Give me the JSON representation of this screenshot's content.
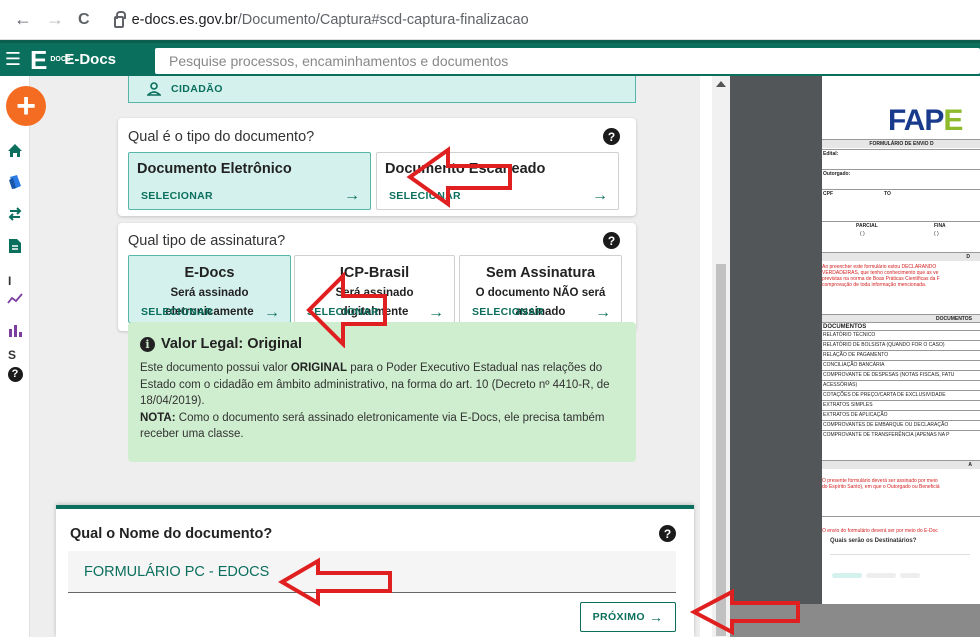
{
  "browser": {
    "back": "←",
    "forward": "→",
    "reload": "C",
    "url_host": "e-docs.es.gov.br",
    "url_path": "/Documento/Captura#scd-captura-finalizacao"
  },
  "app": {
    "name": "E-Docs",
    "logo_letter": "E",
    "logo_sub": "DOCS",
    "search_placeholder": "Pesquise processos, encaminhamentos e documentos"
  },
  "rail": {
    "add_label": "+",
    "sep1": "I",
    "sep2": "S",
    "help": "?"
  },
  "citizen_label": "CIDADÃO",
  "doc_type": {
    "title": "Qual é o tipo do documento?",
    "options": [
      {
        "title": "Documento Eletrônico",
        "action": "SELECIONAR"
      },
      {
        "title": "Documento Escaneado",
        "action": "SELECIONAR"
      }
    ]
  },
  "signature": {
    "title": "Qual tipo de assinatura?",
    "options": [
      {
        "title": "E-Docs",
        "line1": "Será assinado",
        "line2": "eletronicamente",
        "action": "SELECIONAR"
      },
      {
        "title": "ICP-Brasil",
        "line1": "Será assinado",
        "line2": "digitalmente",
        "action": "SELECIONAR"
      },
      {
        "title": "Sem Assinatura",
        "line1": "O documento NÃO será",
        "line2": "assinado",
        "action": "SELECIONAR"
      }
    ]
  },
  "legal": {
    "heading": "Valor Legal: Original",
    "p1a": "Este documento possui valor ",
    "p1b": "ORIGINAL",
    "p1c": " para o Poder Executivo Estadual nas relações do Estado com o cidadão em âmbito administrativo, na forma do art. 10 (Decreto nº 4410-R, de 18/04/2019).",
    "p2a": "NOTA:",
    "p2b": " Como o documento será assinado eletronicamente via E-Docs, ele precisa também receber uma classe."
  },
  "name_panel": {
    "question": "Qual o Nome do documento?",
    "value": "FORMULÁRIO PC - EDOCS",
    "next_label": "PRÓXIMO"
  },
  "preview": {
    "logo_a": "FAP",
    "logo_b": "E",
    "form_title": "FORMULÁRIO DE ENVIO D",
    "edital": "Edital:",
    "outorgado": "Outorgado:",
    "cpf": "CPF",
    "to": "TO",
    "parcial": "PARCIAL",
    "final": "FINA",
    "box": "( )",
    "d_head": "D",
    "red1": "Ao preencher este formulário estou DECLARANDO",
    "red2": "VERDADEIRAS, que tenho conhecimento que as ve",
    "red3": "previstas na norma de Boas Práticas Científicas da F",
    "red4": "comprovação de toda informação mencionada.",
    "docs_head": "DOCUMENTOS",
    "docs_col": "DOCUMENTOS",
    "rows": [
      "RELATÓRIO TÉCNICO",
      "RELATÓRIO DE BOLSISTA (QUANDO FOR O CASO)",
      "RELAÇÃO DE PAGAMENTO",
      "CONCILIAÇÃO BANCÁRIA",
      "COMPROVANTE DE DESPESAS (NOTAS FISCAIS, FATU",
      "ACESSÓRIAS)",
      "COTAÇÕES DE PREÇO/CARTA DE EXCLUSIVIDADE",
      "EXTRATOS SIMPLES",
      "EXTRATOS DE APLICAÇÃO",
      "COMPROVANTES DE EMBARQUE OU DECLARAÇÃO",
      "COMPROVANTE DE TRANSFERÊNCIA (APENAS NA P"
    ],
    "a_head": "A",
    "red5": "O presente formulário deverá ser assinado por meio",
    "red6": "do Espírito Santo), em que o Outorgado ou Beneficiá",
    "red7": "O envio do formulário deverá ser por meio do E-Doc",
    "dest_q": "Quais serão os Destinatários?"
  }
}
